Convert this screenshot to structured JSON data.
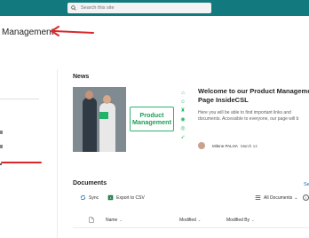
{
  "header": {
    "search_placeholder": "Search this site"
  },
  "site": {
    "title": "Management"
  },
  "news": {
    "heading": "News",
    "image_tagline": "Product Management",
    "article_title_line1": "Welcome to our Product Management",
    "article_title_line2": "Page InsideCSL",
    "article_desc": "Here you will be able to find important links and documents. Accessible to everyone, our page will b",
    "author": "Milene PALHA",
    "date": "March 14"
  },
  "documents": {
    "heading": "Documents",
    "see_all": "Se",
    "sync_label": "Sync",
    "export_label": "Export to CSV",
    "view_label": "All Documents",
    "columns": [
      "Name",
      "Modified",
      "Modified By"
    ]
  },
  "colors": {
    "suite_bar": "#127a7e",
    "annotation_arrow": "#d9282a",
    "brand_green": "#2db46d"
  }
}
